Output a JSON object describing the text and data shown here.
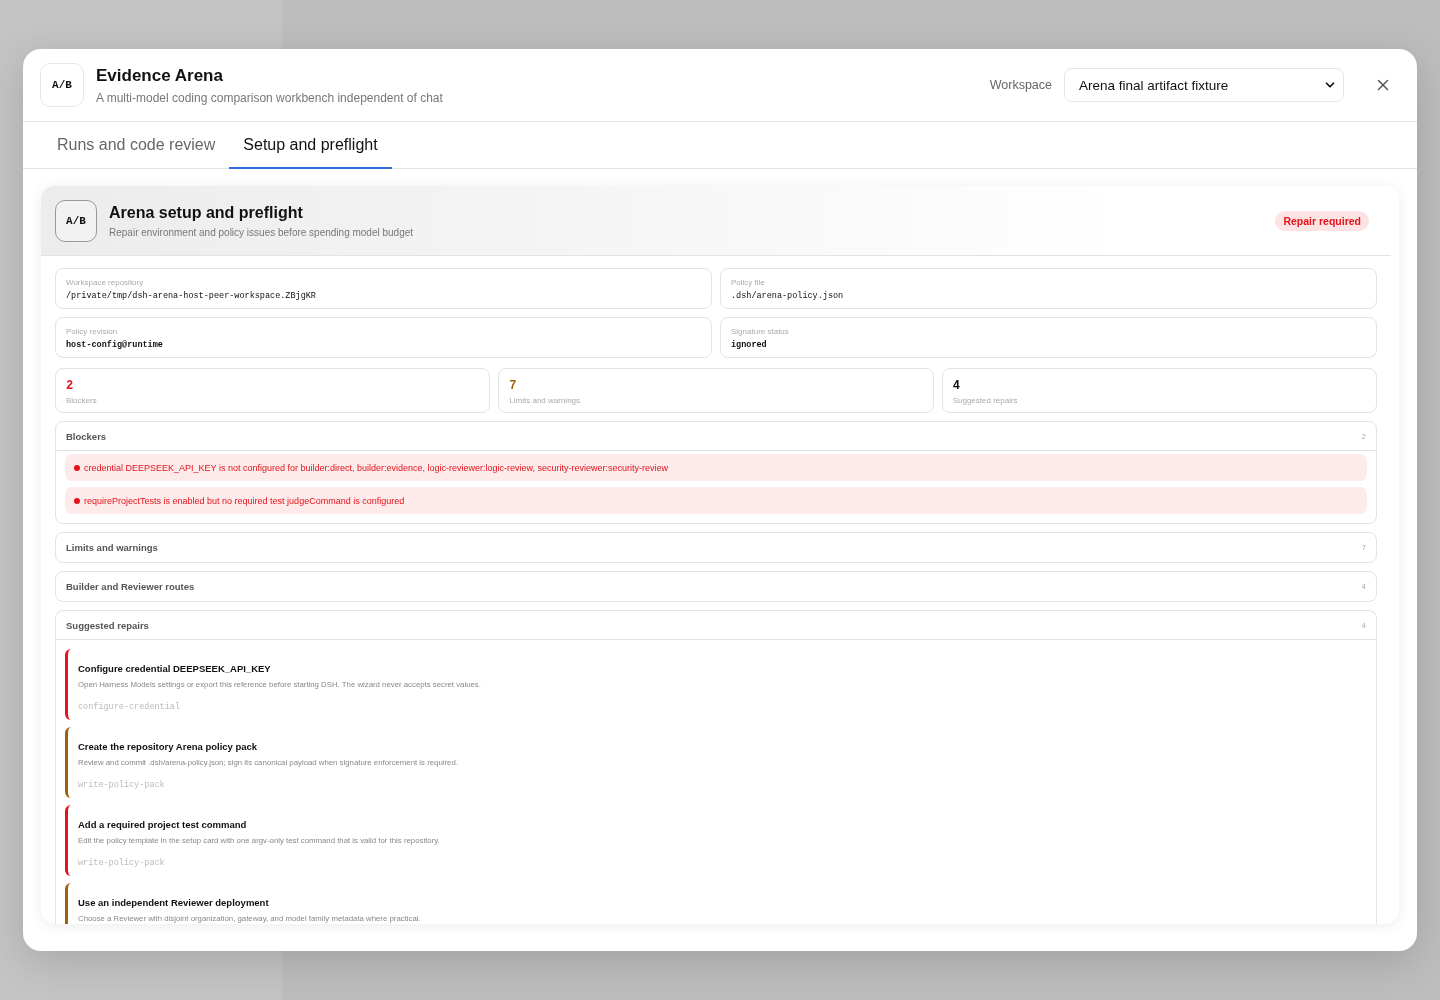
{
  "dialog": {
    "logo": "A/B",
    "title": "Evidence Arena",
    "subtitle": "A multi-model coding comparison workbench independent of chat",
    "workspace_label": "Workspace",
    "workspace_value": "Arena final artifact fixture"
  },
  "tabs": [
    {
      "label": "Runs and code review",
      "selected": false
    },
    {
      "label": "Setup and preflight",
      "selected": true
    }
  ],
  "setup": {
    "logo": "A/B",
    "title": "Arena setup and preflight",
    "subtitle": "Repair environment and policy issues before spending model budget",
    "status": "Repair required",
    "fields": [
      {
        "label": "Workspace repository",
        "value": "/private/tmp/dsh-arena-host-peer-workspace.ZBjgKR",
        "bold": false
      },
      {
        "label": "Policy file",
        "value": ".dsh/arena-policy.json",
        "bold": false
      },
      {
        "label": "Policy revision",
        "value": "host-config@runtime",
        "bold": true
      },
      {
        "label": "Signature status",
        "value": "ignored",
        "bold": true
      }
    ],
    "stats": [
      {
        "value": "2",
        "label": "Blockers",
        "color": "#e5141c"
      },
      {
        "value": "7",
        "label": "Limits and warnings",
        "color": "#a0600a"
      },
      {
        "value": "4",
        "label": "Suggested repairs",
        "color": "#111111"
      }
    ],
    "sections": [
      {
        "kind": "issues",
        "title": "Blockers",
        "count": "2",
        "expanded": true,
        "items": [
          "credential DEEPSEEK_API_KEY is not configured for builder:direct, builder:evidence, logic-reviewer:logic-review, security-reviewer:security-review",
          "requireProjectTests is enabled but no required test judgeCommand is configured"
        ]
      },
      {
        "title": "Limits and warnings",
        "count": "7",
        "expanded": false
      },
      {
        "title": "Builder and Reviewer routes",
        "count": "4",
        "expanded": false
      },
      {
        "kind": "repairs",
        "title": "Suggested repairs",
        "count": "4",
        "expanded": true,
        "repairs": [
          {
            "title": "Configure credential DEEPSEEK_API_KEY",
            "description": "Open Harness Models settings or export this reference before starting DSH. The wizard never accepts secret values.",
            "action": "configure-credential",
            "color": "#e5141c"
          },
          {
            "title": "Create the repository Arena policy pack",
            "description": "Review and commit .dsh/arena-policy.json; sign its canonical payload when signature enforcement is required.",
            "action": "write-policy-pack",
            "color": "#a0600a"
          },
          {
            "title": "Add a required project test command",
            "description": "Edit the policy template in the setup card with one argv-only test command that is valid for this repository.",
            "action": "write-policy-pack",
            "color": "#e5141c"
          },
          {
            "title": "Use an independent Reviewer deployment",
            "description": "Choose a Reviewer with disjoint organization, gateway, and model family metadata where practical.",
            "color": "#a0600a"
          }
        ]
      }
    ]
  }
}
